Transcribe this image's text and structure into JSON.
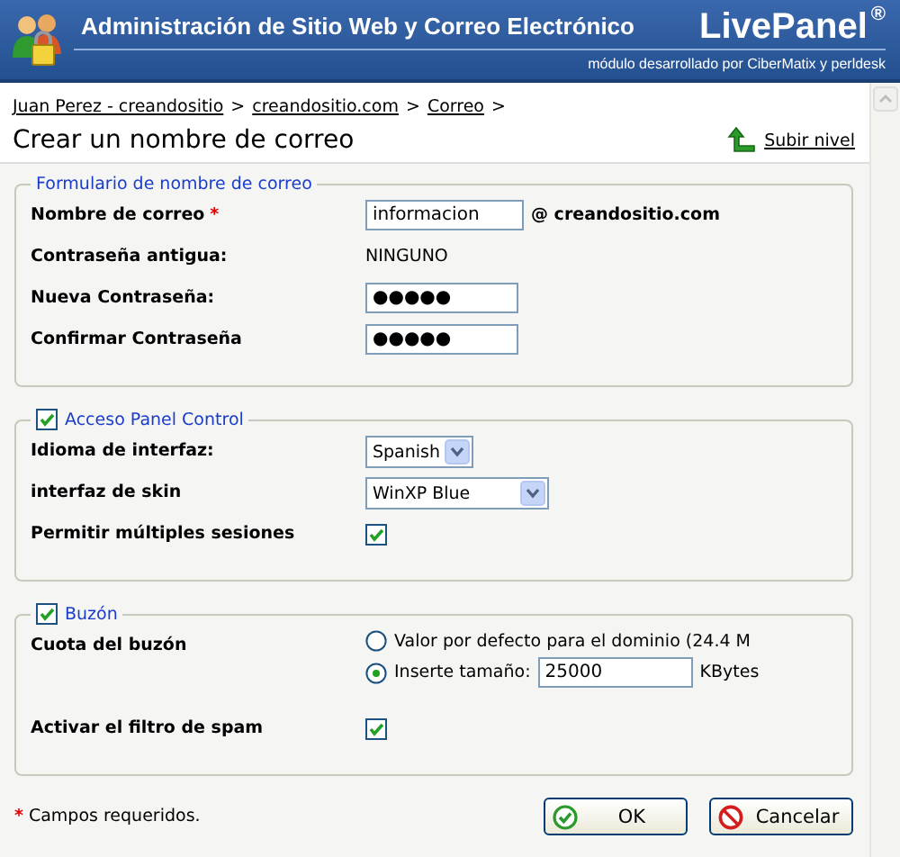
{
  "header": {
    "title": "Administración de Sitio Web y Correo Electrónico",
    "brand": "LivePanel",
    "brand_mark": "®",
    "subtitle": "módulo desarrollado por CiberMatix y perldesk"
  },
  "breadcrumb": [
    {
      "label": "Juan Perez - creandositio",
      "separator": ">"
    },
    {
      "label": "creandositio.com",
      "separator": ">"
    },
    {
      "label": "Correo",
      "separator": ">"
    }
  ],
  "page_title": "Crear un nombre de correo",
  "up_link": "Subir nivel",
  "sections": [
    {
      "legend": "Formulario de nombre de correo",
      "rows": [
        {
          "kind": "text",
          "label": "Nombre de correo",
          "required": true,
          "value": "informacion",
          "suffix": "@ creandositio.com"
        },
        {
          "kind": "static",
          "label": "Contraseña antigua:",
          "required": false,
          "value": "NINGUNO"
        },
        {
          "kind": "password",
          "label": "Nueva Contraseña:",
          "required": false,
          "value": "●●●●●"
        },
        {
          "kind": "password",
          "label": "Confirmar Contraseña",
          "required": false,
          "value": "●●●●●"
        }
      ]
    },
    {
      "legend": "Acceso Panel Control",
      "checked": true,
      "rows": [
        {
          "kind": "select",
          "label": "Idioma de interfaz:",
          "required": false,
          "value": "Spanish"
        },
        {
          "kind": "select",
          "label": "interfaz de skin",
          "required": false,
          "value": "WinXP Blue"
        },
        {
          "kind": "checkbox",
          "label": "Permitir múltiples sesiones",
          "required": false,
          "checked": true
        }
      ]
    },
    {
      "legend": "Buzón",
      "checked": true,
      "rows": [
        {
          "kind": "radios",
          "label": "Cuota del buzón",
          "required": false,
          "options": [
            {
              "kind": "plain",
              "label": "Valor por defecto para el dominio (24.4 M",
              "selected": false
            },
            {
              "kind": "size",
              "label": "Inserte tamaño:",
              "selected": true,
              "value": "25000",
              "unit": "KBytes"
            }
          ]
        },
        {
          "kind": "checkbox",
          "label": "Activar el filtro de spam",
          "required": false,
          "checked": true
        }
      ]
    }
  ],
  "required_mark": "*",
  "footer_note": "Campos requeridos.",
  "buttons": [
    {
      "kind": "ok",
      "label": "OK"
    },
    {
      "kind": "cancel",
      "label": "Cancelar"
    }
  ]
}
